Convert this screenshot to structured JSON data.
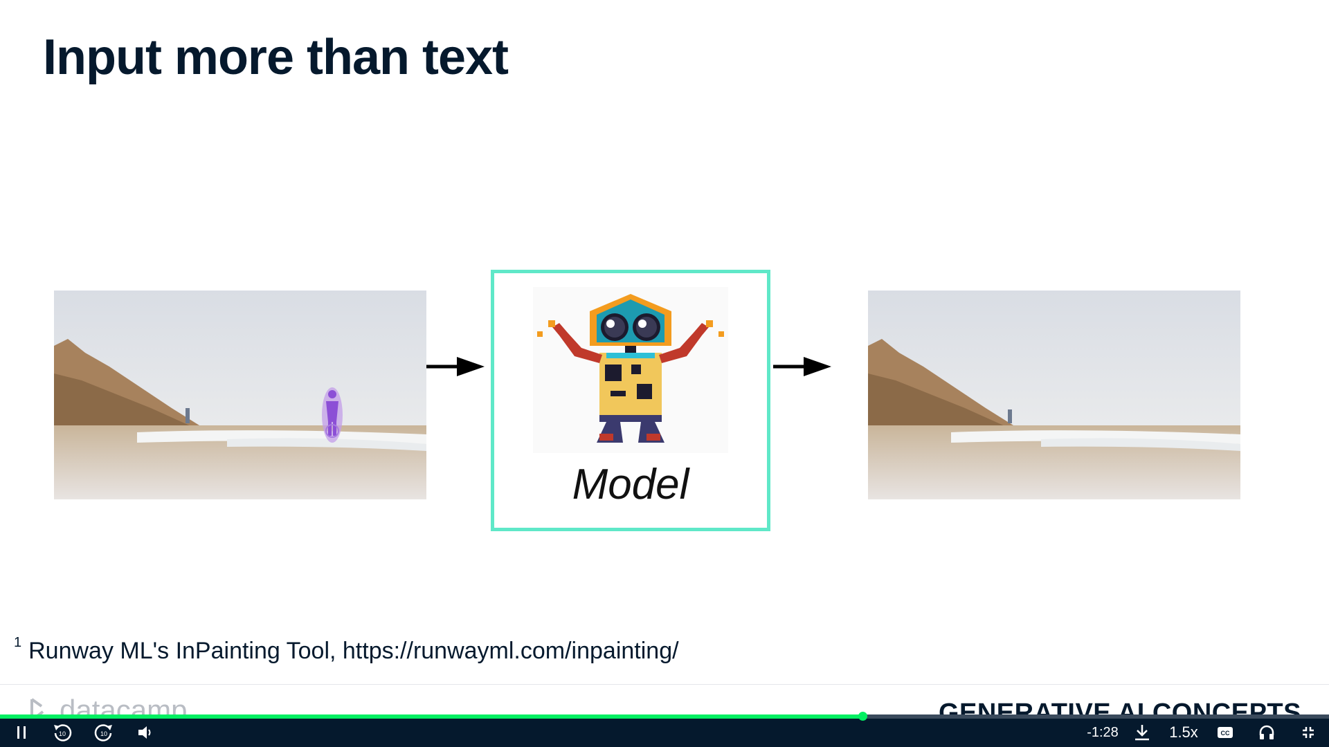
{
  "slide": {
    "title": "Input more than text",
    "model_label": "Model",
    "footnote_number": "1",
    "footnote_text": "Runway ML's InPainting Tool, https://runwayml.com/inpainting/",
    "brand": "datacamp",
    "course": "GENERATIVE AI CONCEPTS",
    "accent_color": "#5fe8c8"
  },
  "player": {
    "progress_percent": 64.9,
    "time_remaining": "-1:28",
    "speed": "1.5x",
    "pause_icon": "pause-icon",
    "rewind_icon": "rewind-10-icon",
    "forward_icon": "forward-10-icon",
    "volume_icon": "volume-icon",
    "download_icon": "download-icon",
    "captions_icon": "captions-icon",
    "audio_icon": "headphones-icon",
    "exit_fullscreen_icon": "exit-fullscreen-icon",
    "progress_color": "#03ef62"
  }
}
